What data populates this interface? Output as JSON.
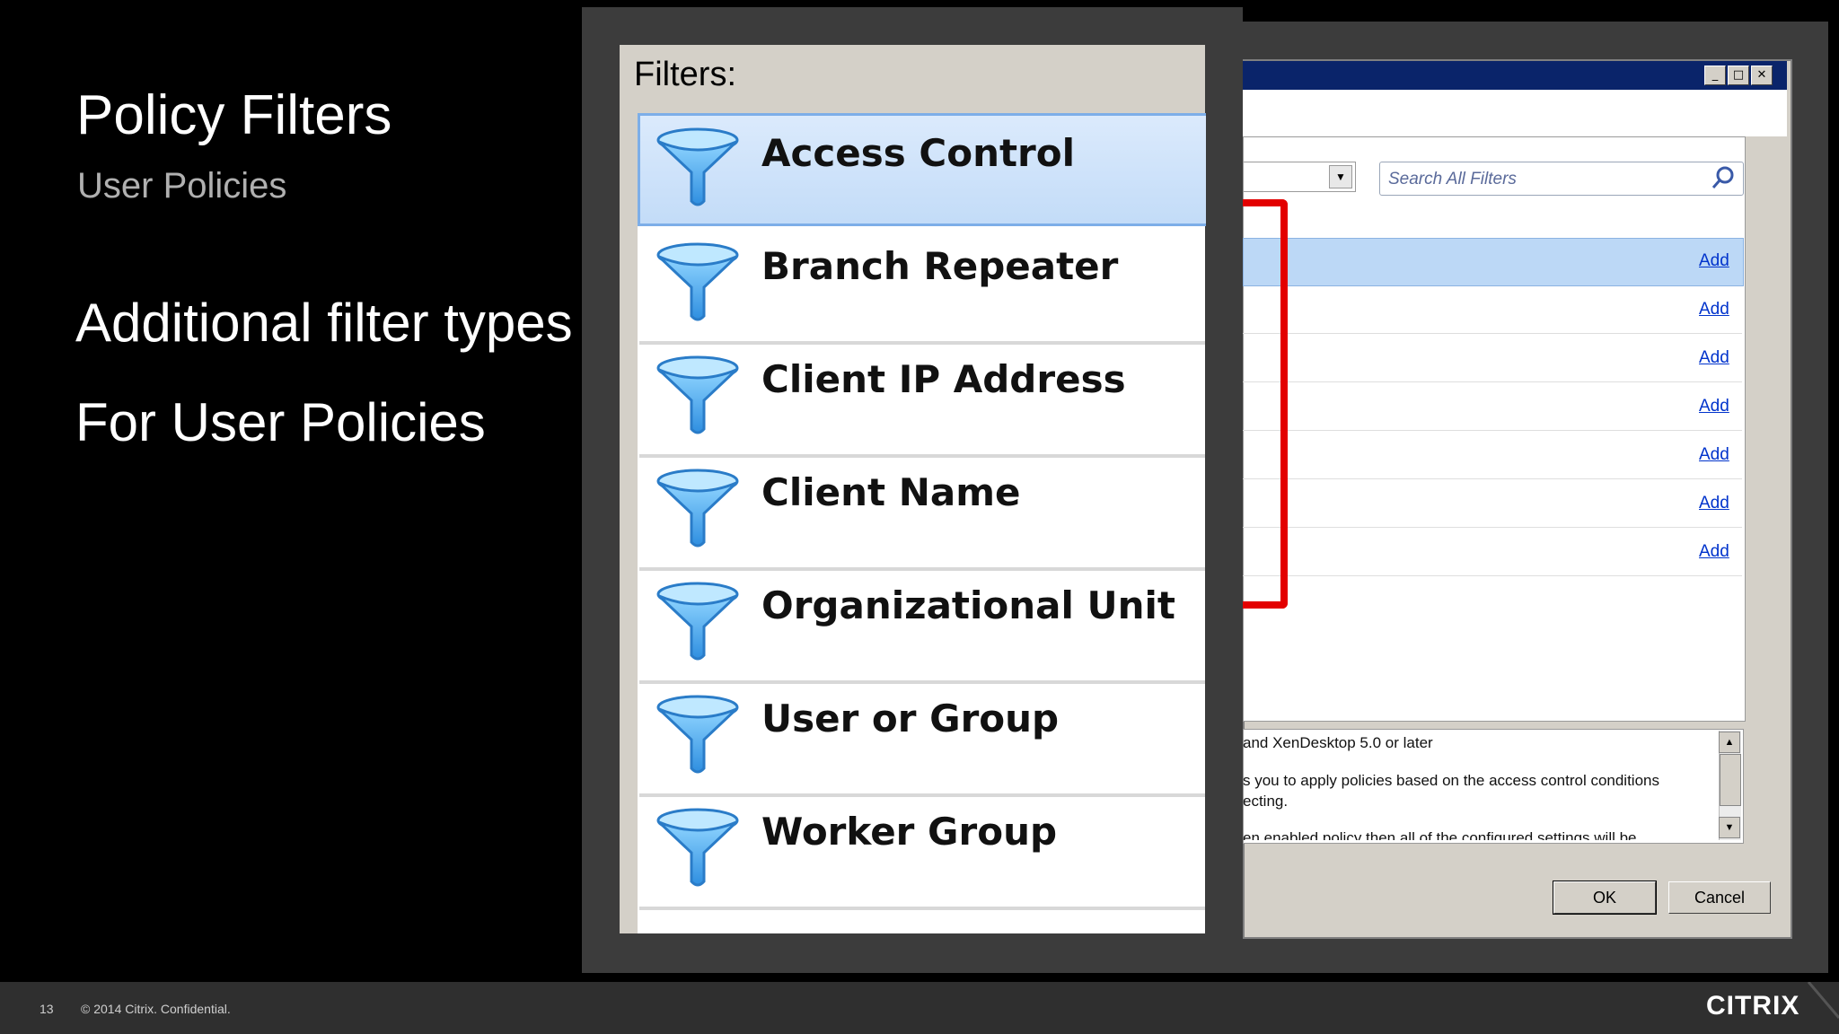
{
  "slide": {
    "title": "Policy Filters",
    "subtitle": "User Policies",
    "bullets": [
      "Additional filter types",
      "For User Policies"
    ]
  },
  "footer": {
    "page_number": "13",
    "copyright": "© 2014 Citrix. Confidential.",
    "logo": "CITRIX"
  },
  "zoom_panel": {
    "header": "Filters:",
    "items": [
      {
        "label": "Access Control",
        "icon": "funnel-icon",
        "selected": true
      },
      {
        "label": "Branch Repeater",
        "icon": "funnel-icon",
        "selected": false
      },
      {
        "label": "Client IP Address",
        "icon": "funnel-icon",
        "selected": false
      },
      {
        "label": "Client Name",
        "icon": "funnel-icon",
        "selected": false
      },
      {
        "label": "Organizational Unit",
        "icon": "funnel-icon",
        "selected": false
      },
      {
        "label": "User or Group",
        "icon": "funnel-icon",
        "selected": false
      },
      {
        "label": "Worker Group",
        "icon": "funnel-icon",
        "selected": false
      }
    ]
  },
  "dialog": {
    "window_buttons": {
      "minimize": "_",
      "maximize": "□",
      "close": "✕"
    },
    "dropdown_arrow": "▼",
    "search_placeholder": "Search All Filters",
    "add_link_label": "Add",
    "rows": [
      {
        "add": "Add"
      },
      {
        "add": "Add"
      },
      {
        "add": "Add"
      },
      {
        "add": "Add"
      },
      {
        "add": "Add"
      },
      {
        "add": "Add"
      },
      {
        "add": "Add"
      }
    ],
    "description_lines": [
      "and XenDesktop 5.0 or later",
      "s you to apply policies based on the access control conditions",
      "ecting.",
      "en enabled policy then all of the configured settings will be"
    ],
    "scroll_up": "▲",
    "scroll_down": "▼",
    "ok_label": "OK",
    "cancel_label": "Cancel"
  },
  "colors": {
    "highlight_bracket": "#e30000",
    "selection_blue": "#bcd8f6",
    "link_blue": "#0033cc",
    "titlebar": "#0a246a"
  }
}
